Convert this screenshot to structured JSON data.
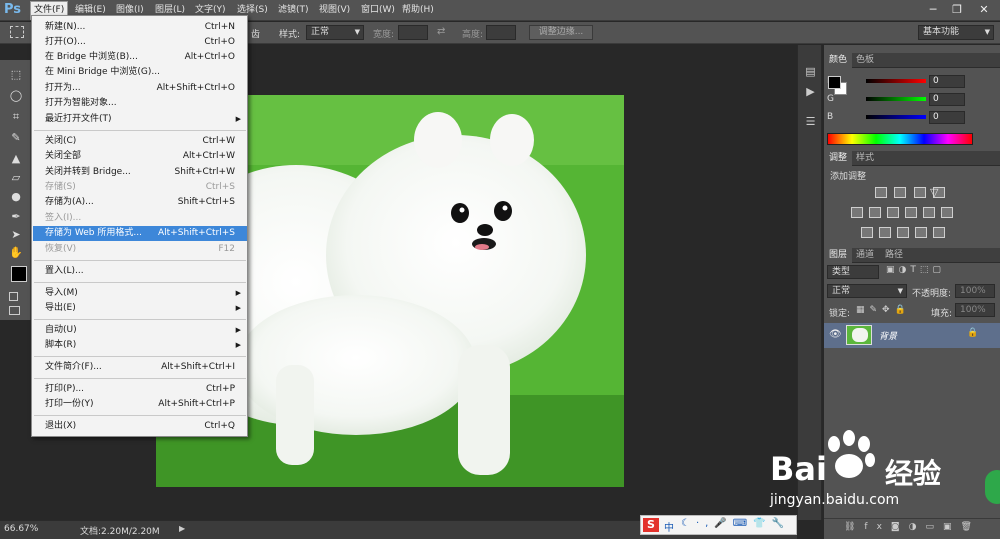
{
  "app": {
    "logo": "Ps"
  },
  "menubar": {
    "items": [
      "文件(F)",
      "编辑(E)",
      "图像(I)",
      "图层(L)",
      "文字(Y)",
      "选择(S)",
      "滤镜(T)",
      "视图(V)",
      "窗口(W)",
      "帮助(H)"
    ],
    "active": "文件(F)",
    "window_controls": {
      "minimize": "─",
      "restore": "❐",
      "close": "✕"
    }
  },
  "options_bar": {
    "fragment_label": "齿",
    "style_label": "样式:",
    "style_value": "正常",
    "width_label": "宽度:",
    "height_label": "高度:",
    "refine_edge_button": "调整边缘...",
    "workspace_value": "基本功能"
  },
  "file_menu": {
    "items": [
      {
        "label": "新建(N)...",
        "shortcut": "Ctrl+N"
      },
      {
        "label": "打开(O)...",
        "shortcut": "Ctrl+O"
      },
      {
        "label": "在 Bridge 中浏览(B)...",
        "shortcut": "Alt+Ctrl+O"
      },
      {
        "label": "在 Mini Bridge 中浏览(G)...",
        "shortcut": ""
      },
      {
        "label": "打开为...",
        "shortcut": "Alt+Shift+Ctrl+O"
      },
      {
        "label": "打开为智能对象...",
        "shortcut": ""
      },
      {
        "label": "最近打开文件(T)",
        "shortcut": "",
        "submenu": true
      },
      {
        "label": "关闭(C)",
        "shortcut": "Ctrl+W"
      },
      {
        "label": "关闭全部",
        "shortcut": "Alt+Ctrl+W"
      },
      {
        "label": "关闭并转到 Bridge...",
        "shortcut": "Shift+Ctrl+W"
      },
      {
        "label": "存储(S)",
        "shortcut": "Ctrl+S",
        "disabled": true
      },
      {
        "label": "存储为(A)...",
        "shortcut": "Shift+Ctrl+S"
      },
      {
        "label": "签入(I)...",
        "shortcut": "",
        "disabled": true
      },
      {
        "label": "存储为 Web 所用格式...",
        "shortcut": "Alt+Shift+Ctrl+S",
        "highlighted": true
      },
      {
        "label": "恢复(V)",
        "shortcut": "F12",
        "disabled": true
      },
      {
        "label": "置入(L)...",
        "shortcut": ""
      },
      {
        "label": "导入(M)",
        "shortcut": "",
        "submenu": true
      },
      {
        "label": "导出(E)",
        "shortcut": "",
        "submenu": true
      },
      {
        "label": "自动(U)",
        "shortcut": "",
        "submenu": true
      },
      {
        "label": "脚本(R)",
        "shortcut": "",
        "submenu": true
      },
      {
        "label": "文件简介(F)...",
        "shortcut": "Alt+Shift+Ctrl+I"
      },
      {
        "label": "打印(P)...",
        "shortcut": "Ctrl+P"
      },
      {
        "label": "打印一份(Y)",
        "shortcut": "Alt+Shift+Ctrl+P"
      },
      {
        "label": "退出(X)",
        "shortcut": "Ctrl+Q"
      }
    ]
  },
  "color_panel": {
    "tabs": [
      "颜色",
      "色板"
    ],
    "channels": [
      {
        "name": "R",
        "value": "0",
        "color": "#d02020"
      },
      {
        "name": "G",
        "value": "0",
        "color": "#20b020"
      },
      {
        "name": "B",
        "value": "0",
        "color": "#2040d0"
      }
    ]
  },
  "adjustments_panel": {
    "tabs": [
      "调整",
      "样式"
    ],
    "title": "添加调整"
  },
  "layers_panel": {
    "tabs": [
      "图层",
      "通道",
      "路径"
    ],
    "filter_label": "类型",
    "blend_mode": "正常",
    "opacity_label": "不透明度:",
    "opacity_value": "100%",
    "lock_label": "锁定:",
    "fill_label": "填充:",
    "fill_value": "100%",
    "layers": [
      {
        "name": "背景"
      }
    ]
  },
  "status_bar": {
    "zoom": "66.67%",
    "doc_info": "文档:2.20M/2.20M"
  },
  "watermark": {
    "brand": "Bai",
    "brand2": "经验",
    "url": "jingyan.baidu.com"
  },
  "ime_bar": {
    "label": "中"
  }
}
